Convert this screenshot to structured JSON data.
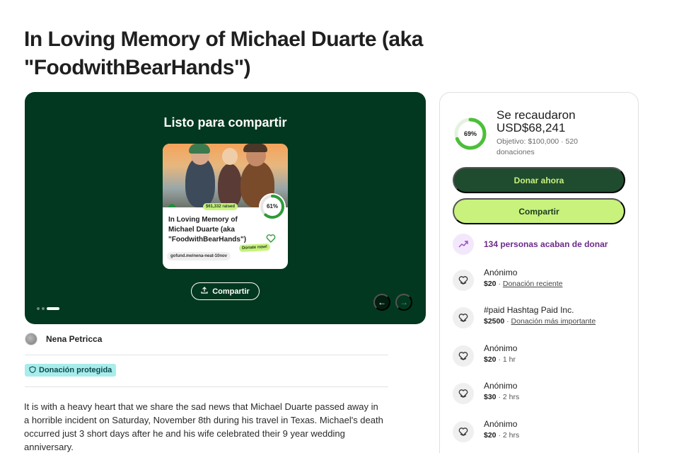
{
  "page_title": "In Loving Memory of Michael Duarte (aka \"FoodwithBearHands\")",
  "hero": {
    "heading": "Listo para compartir",
    "share_button": "Compartir",
    "card": {
      "raised_badge": "$61,332 raised",
      "progress_label": "61%",
      "progress_fraction": 0.61,
      "title": "In Loving Memory of Michael Duarte (aka \"FoodwithBearHands\")",
      "donate_badge": "Donate now!",
      "url": "gofund.me/nena-neat-10nov"
    },
    "carousel_slide_count": 3,
    "carousel_active_index": 2,
    "prev_icon": "arrow-left-icon",
    "next_icon": "arrow-right-icon"
  },
  "organizer": {
    "name": "Nena Petricca"
  },
  "protected_badge": "Donación protegida",
  "story": "It is with a heavy heart that we share the sad news that Michael Duarte passed away in a horrible incident on Saturday, November 8th during his travel in Texas. Michael's death occurred just 3 short days after he and his wife celebrated their 9 year wedding anniversary.",
  "sidebar": {
    "progress_label": "69%",
    "progress_fraction": 0.69,
    "raised_label": "Se recaudaron",
    "raised_amount": "USD$68,241",
    "goal_text": "Objetivo: $100,000 · 520 donaciones",
    "donate_button": "Donar ahora",
    "share_button": "Compartir",
    "trend_text": "134 personas acaban de donar",
    "donations": [
      {
        "name": "Anónimo",
        "amount": "$20",
        "detail": "Donación reciente",
        "detail_link": true
      },
      {
        "name": "#paid Hashtag Paid Inc.",
        "amount": "$2500",
        "detail": "Donación más importante",
        "detail_link": true
      },
      {
        "name": "Anónimo",
        "amount": "$20",
        "detail": "1 hr",
        "detail_link": false
      },
      {
        "name": "Anónimo",
        "amount": "$30",
        "detail": "2 hrs",
        "detail_link": false
      },
      {
        "name": "Anónimo",
        "amount": "$20",
        "detail": "2 hrs",
        "detail_link": false
      }
    ]
  },
  "colors": {
    "hero_bg": "#02381f",
    "accent_lime": "#c8f27c",
    "donate_button_bg": "#1f4b2f",
    "progress_green": "#4cbf3a",
    "trend_purple": "#6d2a8a",
    "protected_bg": "#a9ecec"
  }
}
